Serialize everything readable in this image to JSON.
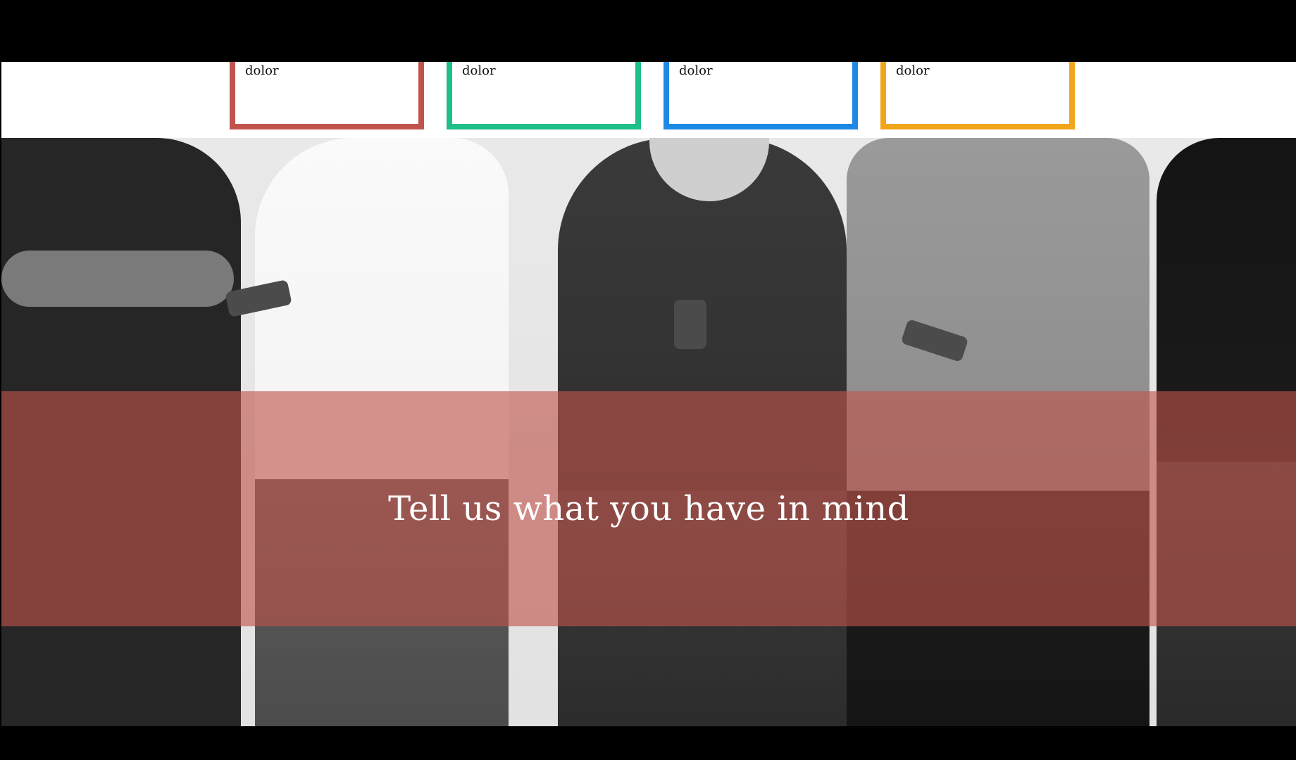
{
  "cards": [
    {
      "label": "dolor",
      "color": "#c0544c"
    },
    {
      "label": "dolor",
      "color": "#1dbf8a"
    },
    {
      "label": "dolor",
      "color": "#1e88e5"
    },
    {
      "label": "dolor",
      "color": "#f0a51a"
    }
  ],
  "hero": {
    "banner_text": "Tell us what you have in mind",
    "banner_color": "#c0544c"
  }
}
